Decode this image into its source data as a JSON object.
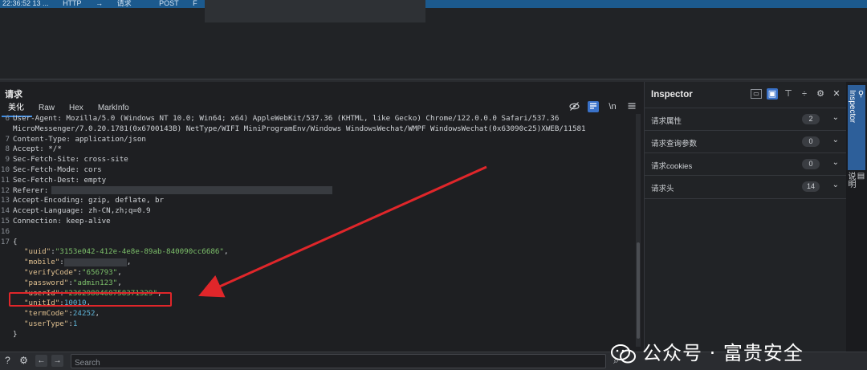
{
  "history": {
    "row": {
      "time": "22:36:52 13 ...",
      "protocol": "HTTP",
      "arrow": "→",
      "type": "请求",
      "method": "POST",
      "extra": "F"
    }
  },
  "request": {
    "title": "请求",
    "tabs": [
      {
        "label": "美化"
      },
      {
        "label": "Raw"
      },
      {
        "label": "Hex"
      },
      {
        "label": "MarkInfo"
      }
    ],
    "lines": [
      {
        "n": "6",
        "text": "User-Agent: Mozilla/5.0 (Windows NT 10.0; Win64; x64) AppleWebKit/537.36 (KHTML, like Gecko) Chrome/122.0.0.0 Safari/537.36"
      },
      {
        "n": "",
        "text": "MicroMessenger/7.0.20.1781(0x6700143B) NetType/WIFI MiniProgramEnv/Windows WindowsWechat/WMPF WindowsWechat(0x63090c25)XWEB/11581"
      },
      {
        "n": "7",
        "text": "Content-Type: application/json"
      },
      {
        "n": "8",
        "text": "Accept: */*"
      },
      {
        "n": "9",
        "text": "Sec-Fetch-Site: cross-site"
      },
      {
        "n": "10",
        "text": "Sec-Fetch-Mode: cors"
      },
      {
        "n": "11",
        "text": "Sec-Fetch-Dest: empty"
      },
      {
        "n": "12",
        "text": "Referer:"
      },
      {
        "n": "13",
        "text": "Accept-Encoding: gzip, deflate, br"
      },
      {
        "n": "14",
        "text": "Accept-Language: zh-CN,zh;q=0.9"
      },
      {
        "n": "15",
        "text": "Connection: keep-alive"
      },
      {
        "n": "16",
        "text": ""
      },
      {
        "n": "17",
        "text": "{"
      }
    ],
    "json": [
      {
        "key": "\"uuid\"",
        "value": "\"3153e042-412e-4e8e-89ab-840090cc6686\"",
        "kind": "str"
      },
      {
        "key": "\"mobile\"",
        "value": "",
        "kind": "redacted"
      },
      {
        "key": "\"verifyCode\"",
        "value": "\"656793\"",
        "kind": "str"
      },
      {
        "key": "\"password\"",
        "value": "\"admin123\"",
        "kind": "str"
      },
      {
        "key": "\"userId\"",
        "value": "\"2362980460758371329\"",
        "kind": "str"
      },
      {
        "key": "\"unitId\"",
        "value": "10010",
        "kind": "num"
      },
      {
        "key": "\"termCode\"",
        "value": "24252",
        "kind": "num"
      },
      {
        "key": "\"userType\"",
        "value": "1",
        "kind": "num"
      }
    ],
    "closing": "}",
    "tools": {
      "wrap": "\\n"
    }
  },
  "inspector": {
    "title": "Inspector",
    "rows": [
      {
        "label": "请求属性",
        "count": "2"
      },
      {
        "label": "请求查询参数",
        "count": "0"
      },
      {
        "label": "请求cookies",
        "count": "0"
      },
      {
        "label": "请求头",
        "count": "14"
      }
    ]
  },
  "side_tabs": [
    {
      "label": "Inspector"
    },
    {
      "label": "说明"
    }
  ],
  "bottom": {
    "search_placeholder": "Search"
  },
  "watermark": {
    "text": "公众号 · 富贵安全"
  }
}
